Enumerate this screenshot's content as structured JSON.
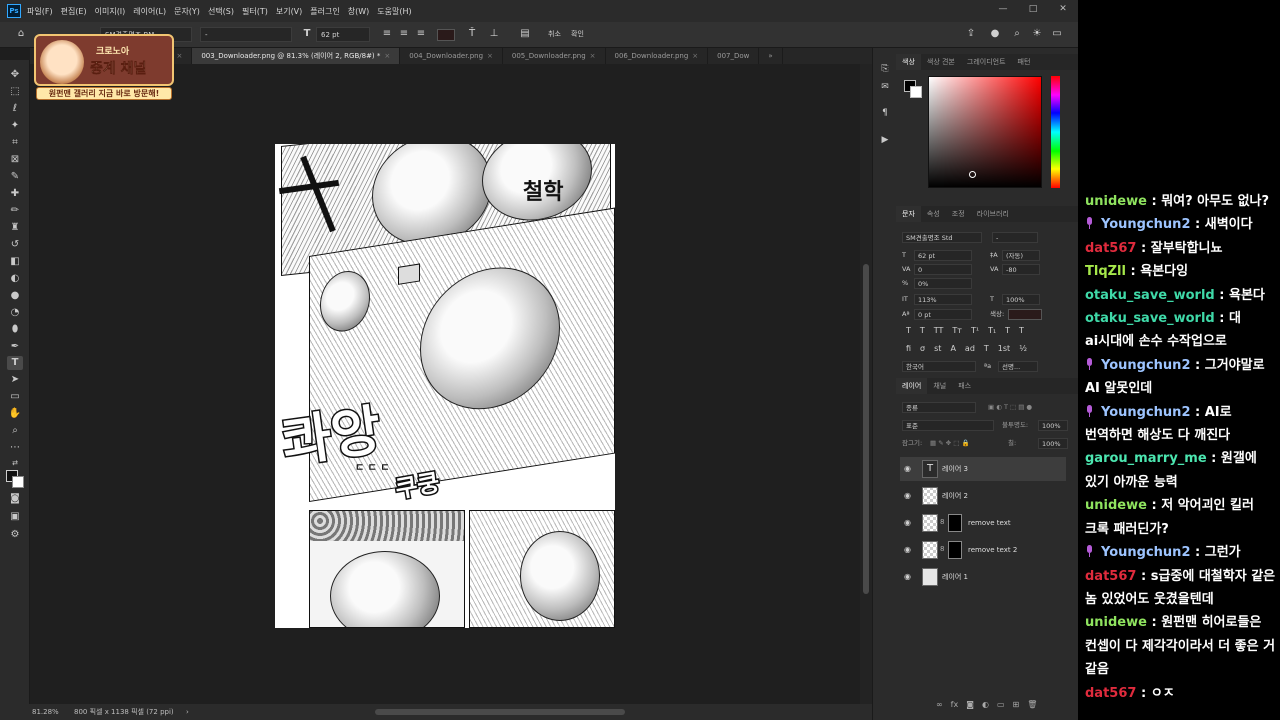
{
  "colors": {
    "accent_blue": "#31a8ff",
    "user_unidewe": "#8fe35f",
    "user_youngchun2": "#9dc4ff",
    "user_dat567": "#e02b3d",
    "user_tlqzii": "#a6e84b",
    "user_otaku": "#3fd9a8",
    "user_garou": "#4ce6b0",
    "mic_badge": "#b55bd8"
  },
  "menubar": {
    "app_icon": "Ps",
    "items": [
      "파일(F)",
      "편집(E)",
      "이미지(I)",
      "레이어(L)",
      "문자(Y)",
      "선택(S)",
      "필터(T)",
      "보기(V)",
      "플러그인",
      "창(W)",
      "도움말(H)"
    ],
    "minimize": "—",
    "maximize": "□",
    "close": "✕"
  },
  "options_bar": {
    "font_family": "SM견출명조 BM",
    "font_style": "-",
    "font_size": "62 pt",
    "extra_label_1": "취소",
    "extra_label_2": "확인"
  },
  "tabs": [
    {
      "label": "ader.png"
    },
    {
      "label": "002_Downloader.png"
    },
    {
      "label": "003_Downloader.png @ 81.3% (레이어 2, RGB/8#) *",
      "active": true
    },
    {
      "label": "004_Downloader.png"
    },
    {
      "label": "005_Downloader.png"
    },
    {
      "label": "006_Downloader.png"
    },
    {
      "label": "007_Dow"
    }
  ],
  "tab_more": "»",
  "canvas": {
    "sfx_main": "콰앙",
    "sfx_top": "철학",
    "sfx_small": "쿠쿵",
    "sfx_drip": "ㄷ ㄷ ㄷ"
  },
  "status": {
    "zoom": "81.28%",
    "doc_info": "800 픽셀 x 1138 픽셀 (72 ppi)",
    "nav": "›"
  },
  "color_panel": {
    "tabs": [
      "색상",
      "색상 견본",
      "그레이디언트",
      "패턴"
    ]
  },
  "character_panel": {
    "tabs": [
      "문자",
      "속성",
      "조정",
      "라이브러리"
    ],
    "font_family": "SM견출명조 Std",
    "font_style": "-",
    "size": "62 pt",
    "leading": "(자동)",
    "kerning": "0",
    "tracking": "-80",
    "tsume": "0%",
    "vscale": "113%",
    "hscale": "100%",
    "baseline": "0 pt",
    "color_label": "색상:",
    "glyphs": [
      "T",
      "T",
      "TT",
      "Tт",
      "T¹",
      "T₁",
      "T",
      "T"
    ],
    "glyphs2": [
      "fi",
      "σ",
      "st",
      "A",
      "ad",
      "T",
      "1st",
      "½"
    ],
    "language": "한국어",
    "aa_label": "ªa",
    "aa_value": "선명..."
  },
  "layers_panel": {
    "tabs": [
      "레이어",
      "채널",
      "패스"
    ],
    "filter": "종류",
    "blend_mode": "표준",
    "opacity_label": "불투명도:",
    "opacity": "100%",
    "lock_label": "잠그기:",
    "fill_label": "칠:",
    "fill": "100%",
    "layers": [
      {
        "name": "레이어 3",
        "type": "text",
        "selected": true
      },
      {
        "name": "레이어 2",
        "type": "pixel"
      },
      {
        "name": "remove text",
        "type": "masked"
      },
      {
        "name": "remove text 2",
        "type": "masked"
      },
      {
        "name": "레이어 1",
        "type": "image"
      }
    ],
    "footer_icons": [
      "link-icon",
      "fx-icon",
      "mask-icon",
      "adjust-icon",
      "folder-icon",
      "new-layer-icon",
      "trash-icon"
    ]
  },
  "overlay_logo": {
    "line1": "크로노아",
    "line2": "중계 채널",
    "tagline": "원펀맨 갤러리 지금 바로 방문해!"
  },
  "chat": [
    {
      "user": "unidewe",
      "color": "user_unidewe",
      "text": "뭐여? 아무도 없나?",
      "mic": false
    },
    {
      "user": "Youngchun2",
      "color": "user_youngchun2",
      "text": "새벽이다",
      "mic": true
    },
    {
      "user": "dat567",
      "color": "user_dat567",
      "text": "잘부탁합니뇨",
      "mic": false
    },
    {
      "user": "TlqZll",
      "color": "user_tlqzii",
      "text": "욕본다잉",
      "mic": false
    },
    {
      "user": "otaku_save_world",
      "color": "user_otaku",
      "text": "욕본다",
      "mic": false
    },
    {
      "user": "otaku_save_world",
      "color": "user_otaku",
      "text": "대 ai시대에 손수 수작업으로",
      "mic": false
    },
    {
      "user": "Youngchun2",
      "color": "user_youngchun2",
      "text": "그거야말로 AI 알못인데",
      "mic": true
    },
    {
      "user": "Youngchun2",
      "color": "user_youngchun2",
      "text": "AI로 번역하면 해상도 다 깨진다",
      "mic": true
    },
    {
      "user": "garou_marry_me",
      "color": "user_garou",
      "text": "원갤에 있기 아까운 능력",
      "mic": false
    },
    {
      "user": "unidewe",
      "color": "user_unidewe",
      "text": "저 악어괴인 킬러 크록 패러딘가?",
      "mic": false
    },
    {
      "user": "Youngchun2",
      "color": "user_youngchun2",
      "text": "그런가",
      "mic": true
    },
    {
      "user": "dat567",
      "color": "user_dat567",
      "text": "s급중에 대철학자 같은 놈 있었어도 웃겼을텐데",
      "mic": false
    },
    {
      "user": "unidewe",
      "color": "user_unidewe",
      "text": "원펀맨 히어로들은 컨셉이 다 제각각이라서 더 좋은 거 같음",
      "mic": false
    },
    {
      "user": "dat567",
      "color": "user_dat567",
      "text": "ㅇㅈ",
      "mic": false
    }
  ]
}
